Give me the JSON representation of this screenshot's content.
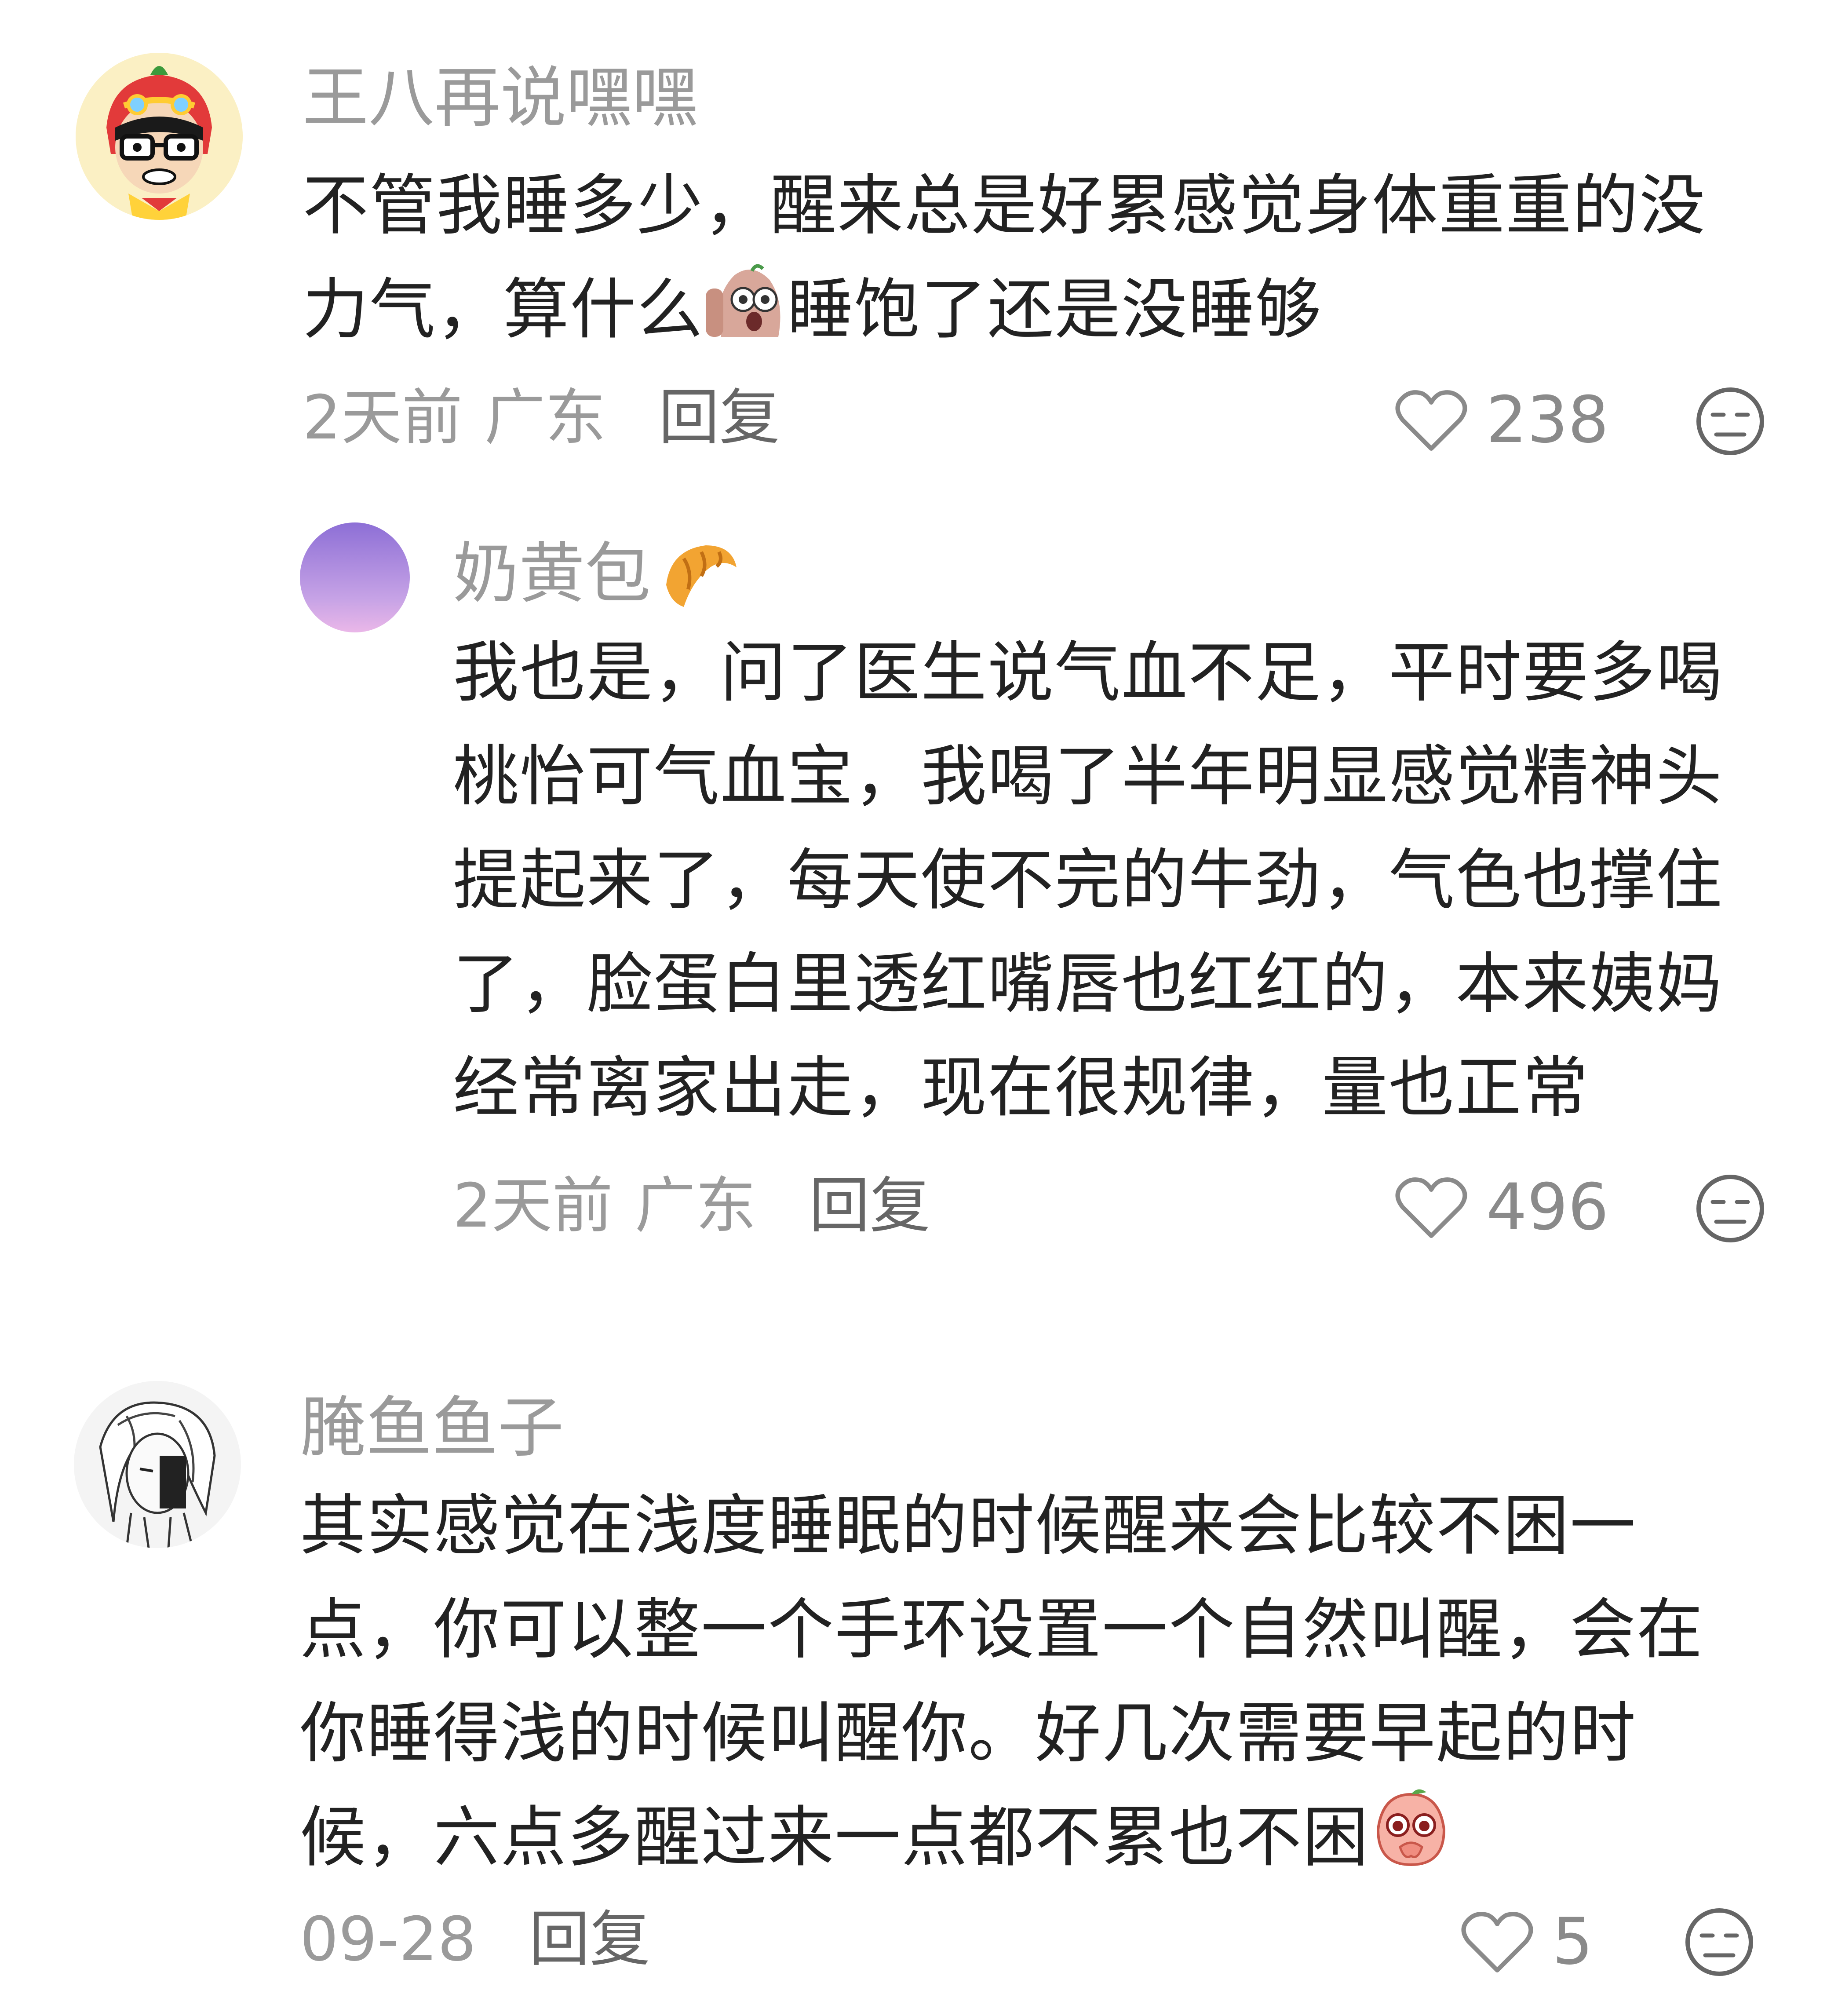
{
  "comments": [
    {
      "username": "王八再说嘿嘿",
      "text_before_emoji": "不管我睡多少，醒来总是好累感觉身体重重的没力气，算什么",
      "text_after_emoji": "睡饱了还是没睡够",
      "time": "2天前",
      "location": "广东",
      "reply_label": "回复",
      "likes": "238",
      "emoji_icon": "shocked-potato-sticker-icon"
    },
    {
      "username": "奶黄包",
      "name_emoji": "croissant-icon",
      "text": "我也是，问了医生说气血不足，平时要多喝桃怡可气血宝，我喝了半年明显感觉精神头提起来了，每天使不完的牛劲，气色也撑住了，脸蛋白里透红嘴唇也红红的，本来姨妈经常离家出走，现在很规律，量也正常",
      "time": "2天前",
      "location": "广东",
      "reply_label": "回复",
      "likes": "496"
    },
    {
      "username": "腌鱼鱼子",
      "text_before_emoji": "其实感觉在浅度睡眠的时候醒来会比较不困一点，你可以整一个手环设置一个自然叫醒，会在你睡得浅的时候叫醒你。好几次需要早起的时候，六点多醒过来一点都不累也不困",
      "time": "09-28",
      "reply_label": "回复",
      "likes": "5",
      "emoji_icon": "pleading-peach-sticker-icon"
    }
  ],
  "colors": {
    "text": "#222222",
    "muted": "#9a9a9a",
    "reply": "#666666"
  }
}
